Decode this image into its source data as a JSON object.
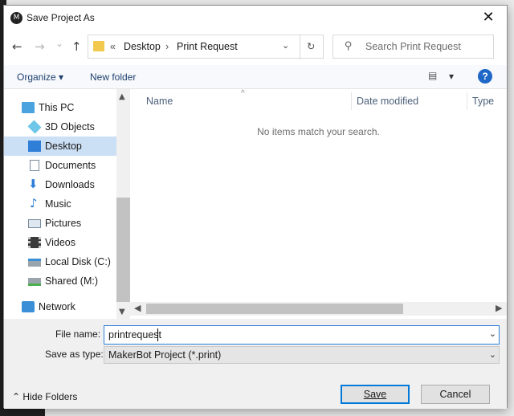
{
  "window": {
    "title": "Save Project As",
    "close": "✕"
  },
  "nav": {
    "back": "←",
    "forward": "→",
    "recent": "⌄",
    "up": "↑",
    "breadcrumb_prefix": "«",
    "crumbs": [
      "Desktop",
      "Print Request"
    ],
    "crumb_sep": "›",
    "dropdown": "⌄",
    "refresh": "↻",
    "search_placeholder": "Search Print Request"
  },
  "commands": {
    "organize": "Organize ▾",
    "new_folder": "New folder",
    "view": "▤",
    "view_dd": "▾",
    "help": "?"
  },
  "sidebar": {
    "items": [
      {
        "label": "This PC",
        "icon": "pc-icon",
        "selected": false
      },
      {
        "label": "3D Objects",
        "icon": "3d-objects-icon",
        "selected": false
      },
      {
        "label": "Desktop",
        "icon": "desktop-icon",
        "selected": true
      },
      {
        "label": "Documents",
        "icon": "documents-icon",
        "selected": false
      },
      {
        "label": "Downloads",
        "icon": "downloads-icon",
        "selected": false
      },
      {
        "label": "Music",
        "icon": "music-icon",
        "selected": false
      },
      {
        "label": "Pictures",
        "icon": "pictures-icon",
        "selected": false
      },
      {
        "label": "Videos",
        "icon": "videos-icon",
        "selected": false
      },
      {
        "label": "Local Disk (C:)",
        "icon": "drive-icon",
        "selected": false
      },
      {
        "label": "Shared (M:)",
        "icon": "network-drive-icon",
        "selected": false
      },
      {
        "label": "Network",
        "icon": "network-icon",
        "selected": false
      }
    ]
  },
  "files": {
    "columns": [
      "Name",
      "Date modified",
      "Type"
    ],
    "sort_indicator": "^",
    "empty_message": "No items match your search."
  },
  "form": {
    "file_name_label": "File name:",
    "file_name_value": "printrequest",
    "save_type_label": "Save as type:",
    "save_type_value": "MakerBot Project (*.print)",
    "dropdown": "⌄"
  },
  "footer": {
    "hide_folders": "⌃  Hide Folders",
    "save": "Save",
    "cancel": "Cancel"
  },
  "scroll": {
    "up": "▲",
    "down": "▼",
    "left": "◀",
    "right": "▶"
  },
  "colors": {
    "accent": "#0078d7",
    "selection": "#cce0f5",
    "help": "#1f67c7"
  }
}
